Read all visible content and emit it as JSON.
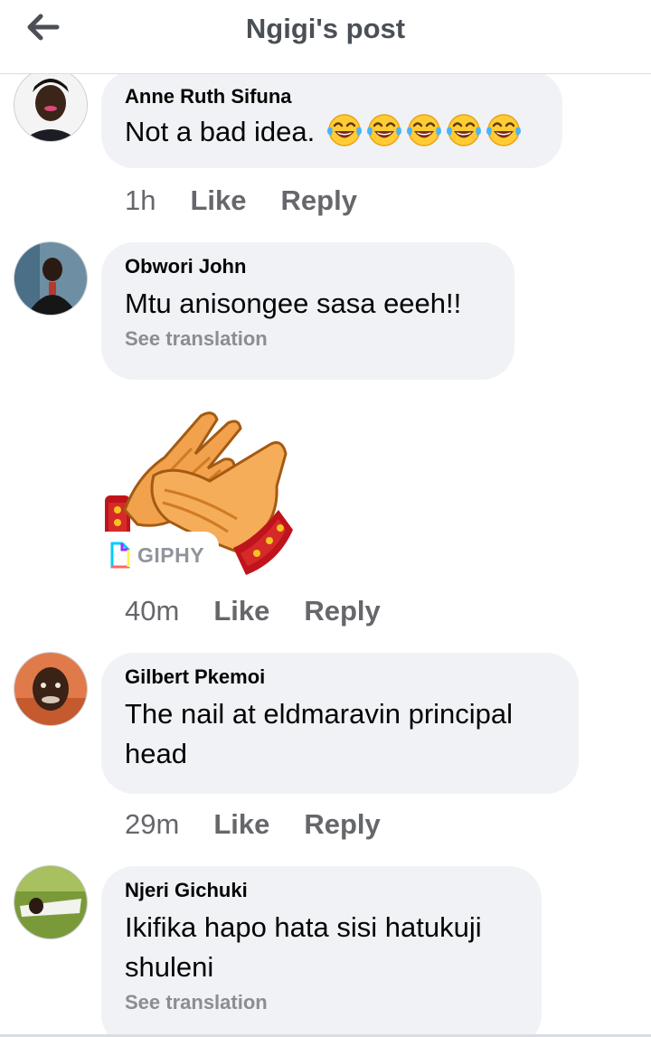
{
  "header": {
    "title": "Ngigi's post",
    "back_icon": "arrow-left-icon"
  },
  "comments": [
    {
      "author": "Anne Ruth Sifuna",
      "text": "Not a bad idea.",
      "emoji_count": 5,
      "emoji": "face-with-tears-of-joy-icon",
      "time": "1h",
      "like": "Like",
      "reply": "Reply"
    },
    {
      "author": "Obwori John",
      "text": "Mtu anisongee sasa eeeh!!",
      "translation": "See translation"
    },
    {
      "gif": "clapping-hands-gif",
      "gif_source": "GIPHY",
      "time": "40m",
      "like": "Like",
      "reply": "Reply"
    },
    {
      "author": "Gilbert Pkemoi",
      "text_line1": "The nail at eldmaravin principal",
      "text_line2": "head",
      "time": "29m",
      "like": "Like",
      "reply": "Reply"
    },
    {
      "author": "Njeri Gichuki",
      "text_line1": "Ikifika hapo hata sisi hatukuji",
      "text_line2": "shuleni",
      "translation": "See translation"
    }
  ],
  "colors": {
    "bubble": "#f0f2f5",
    "meta": "#65676b",
    "translate": "#8a8d91"
  }
}
